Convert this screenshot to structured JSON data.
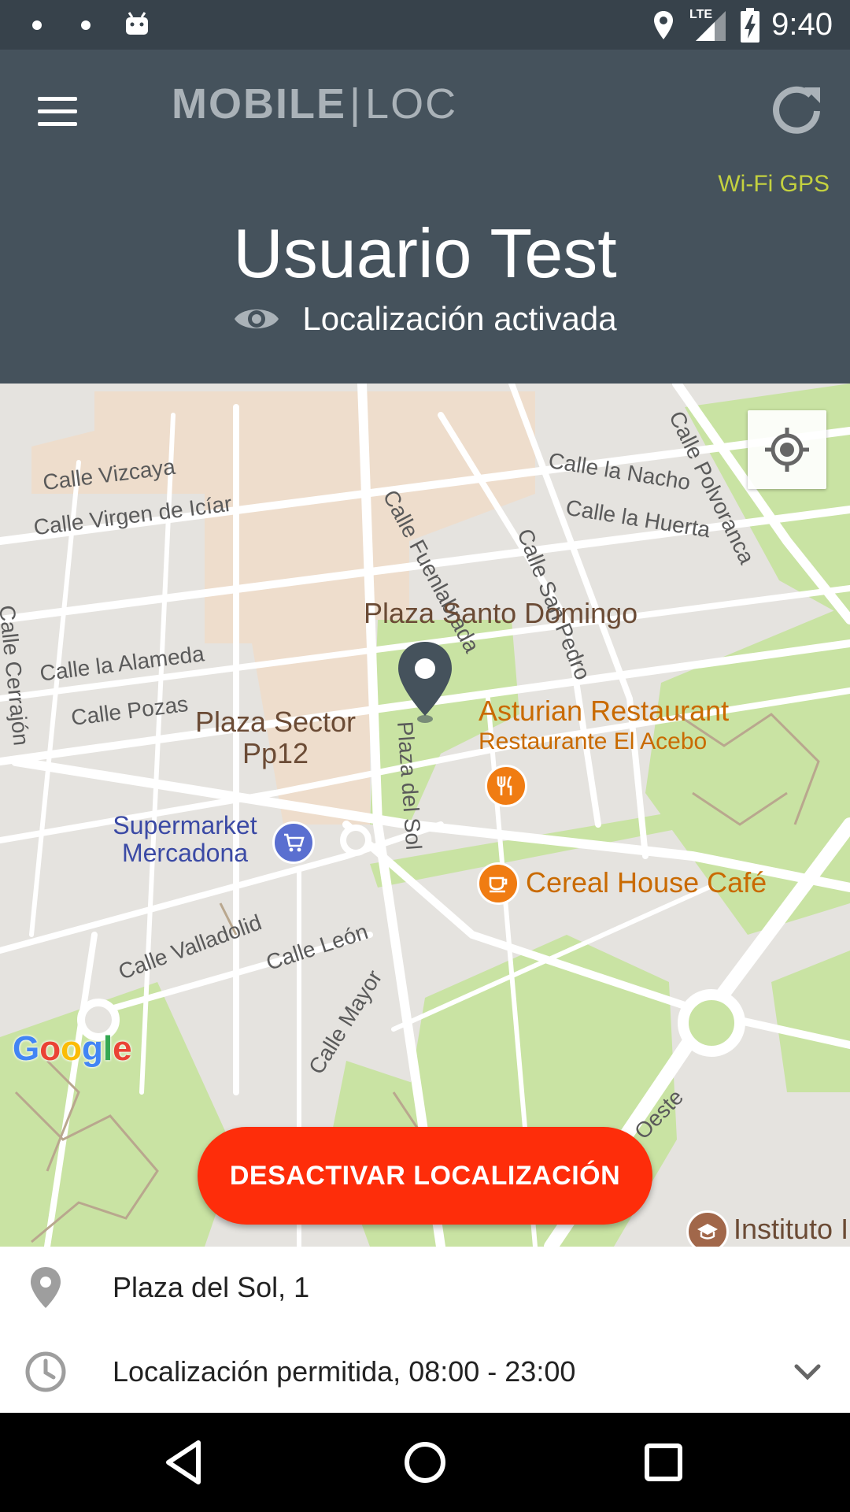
{
  "status_bar": {
    "time": "9:40",
    "network": "LTE",
    "icons": [
      "notification-dot-icon",
      "notification-dot-icon",
      "android-icon",
      "location-icon",
      "signal-icon",
      "battery-charging-icon"
    ]
  },
  "header": {
    "brand_bold": "MOBILE",
    "brand_light": "LOC",
    "connection_mode": "Wi-Fi GPS",
    "user_name": "Usuario Test",
    "location_status": "Localización activada"
  },
  "map": {
    "streets": [
      "Calle Vizcaya",
      "Calle Virgen de Icíar",
      "Calle Fuenlabrada",
      "Calle la Nacho",
      "Calle la Huerta",
      "Calle Polvoranca",
      "Calle San Pedro",
      "Calle Cerrajón",
      "Calle la Alameda",
      "Calle Pozas",
      "Plaza del Sol",
      "Calle Valladolid",
      "Calle León",
      "Calle Mayor",
      "Oeste"
    ],
    "places": {
      "plaza_santo_domingo": "Plaza Santo Domingo",
      "plaza_sector": "Plaza Sector Pp12",
      "asturian_restaurant": "Asturian Restaurant",
      "restaurante_acebo": "Restaurante El Acebo",
      "supermarket": "Supermarket Mercadona",
      "cereal_house": "Cereal House Café",
      "instituto": "Instituto I"
    },
    "attribution": "Google",
    "action_button": "DESACTIVAR LOCALIZACIÓN"
  },
  "info": {
    "address": "Plaza del Sol, 1",
    "schedule": "Localización permitida, 08:00 - 23:00"
  },
  "colors": {
    "status_bar": "#37424b",
    "header": "#45525c",
    "accent_green": "#c4d13f",
    "action_red": "#fe2d0a"
  }
}
